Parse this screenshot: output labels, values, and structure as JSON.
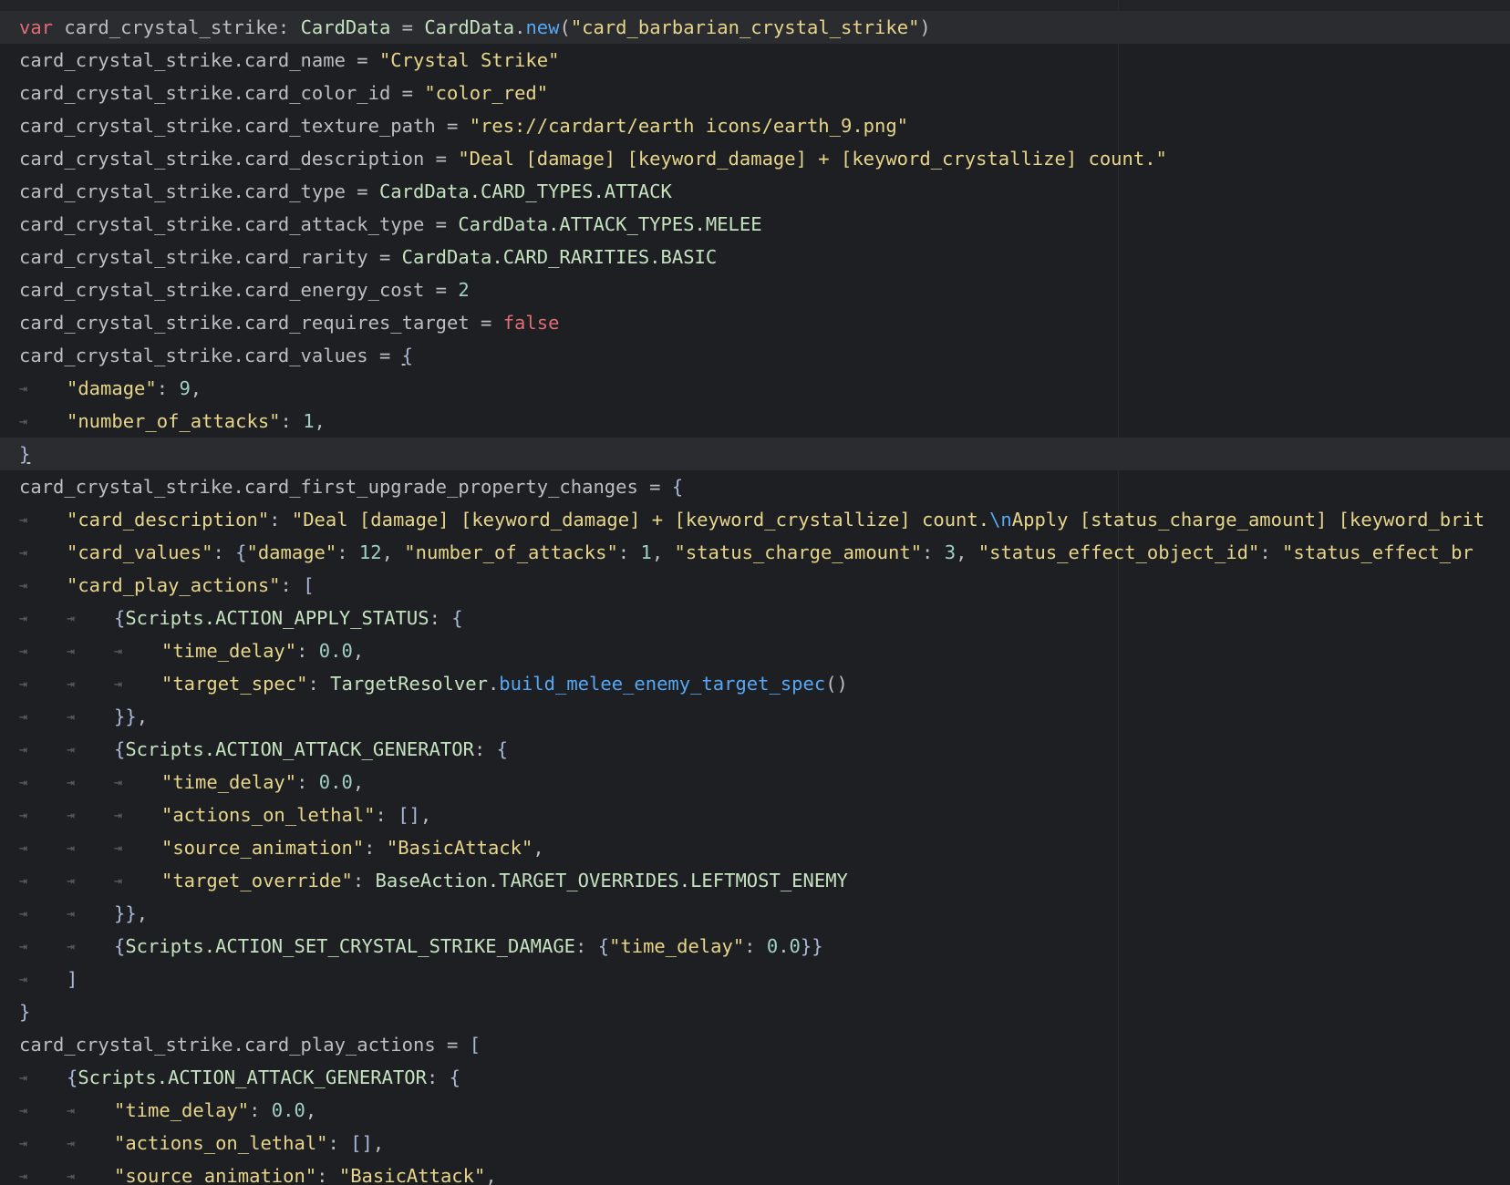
{
  "theme": {
    "background": "#1e1f22",
    "keyword": "#e06c75",
    "string": "#e6d58a",
    "number": "#9fd0c8",
    "function": "#56a8f5",
    "text": "#bcbec4"
  },
  "code": {
    "lines": [
      {
        "indent": 0,
        "highlighted": true,
        "tokens": [
          {
            "t": "var",
            "c": "k"
          },
          {
            "t": " card_crystal_strike: ",
            "c": "p"
          },
          {
            "t": "CardData",
            "c": "t"
          },
          {
            "t": " = ",
            "c": "p"
          },
          {
            "t": "CardData",
            "c": "t"
          },
          {
            "t": ".",
            "c": "p"
          },
          {
            "t": "new",
            "c": "f"
          },
          {
            "t": "(",
            "c": "p"
          },
          {
            "t": "\"card_barbarian_crystal_strike\"",
            "c": "s"
          },
          {
            "t": ")",
            "c": "p"
          }
        ]
      },
      {
        "indent": 0,
        "tokens": [
          {
            "t": "card_crystal_strike.card_name = ",
            "c": "p"
          },
          {
            "t": "\"Crystal Strike\"",
            "c": "s"
          }
        ]
      },
      {
        "indent": 0,
        "tokens": [
          {
            "t": "card_crystal_strike.card_color_id = ",
            "c": "p"
          },
          {
            "t": "\"color_red\"",
            "c": "s"
          }
        ]
      },
      {
        "indent": 0,
        "tokens": [
          {
            "t": "card_crystal_strike.card_texture_path = ",
            "c": "p"
          },
          {
            "t": "\"res://cardart/earth icons/earth_9.png\"",
            "c": "s"
          }
        ]
      },
      {
        "indent": 0,
        "tokens": [
          {
            "t": "card_crystal_strike.card_description = ",
            "c": "p"
          },
          {
            "t": "\"Deal [damage] [keyword_damage] + [keyword_crystallize] count.\"",
            "c": "s"
          }
        ]
      },
      {
        "indent": 0,
        "tokens": [
          {
            "t": "card_crystal_strike.card_type = ",
            "c": "p"
          },
          {
            "t": "CardData.CARD_TYPES.ATTACK",
            "c": "t"
          }
        ]
      },
      {
        "indent": 0,
        "tokens": [
          {
            "t": "card_crystal_strike.card_attack_type = ",
            "c": "p"
          },
          {
            "t": "CardData.ATTACK_TYPES.MELEE",
            "c": "t"
          }
        ]
      },
      {
        "indent": 0,
        "tokens": [
          {
            "t": "card_crystal_strike.card_rarity = ",
            "c": "p"
          },
          {
            "t": "CardData.CARD_RARITIES.BASIC",
            "c": "t"
          }
        ]
      },
      {
        "indent": 0,
        "tokens": [
          {
            "t": "card_crystal_strike.card_energy_cost = ",
            "c": "p"
          },
          {
            "t": "2",
            "c": "n"
          }
        ]
      },
      {
        "indent": 0,
        "tokens": [
          {
            "t": "card_crystal_strike.card_requires_target = ",
            "c": "p"
          },
          {
            "t": "false",
            "c": "k"
          }
        ]
      },
      {
        "indent": 0,
        "tokens": [
          {
            "t": "card_crystal_strike.card_values = ",
            "c": "p"
          },
          {
            "t": "{",
            "c": "br",
            "u": true
          }
        ]
      },
      {
        "indent": 1,
        "tokens": [
          {
            "t": "\"damage\"",
            "c": "s"
          },
          {
            "t": ": ",
            "c": "p"
          },
          {
            "t": "9",
            "c": "n"
          },
          {
            "t": ",",
            "c": "p"
          }
        ]
      },
      {
        "indent": 1,
        "tokens": [
          {
            "t": "\"number_of_attacks\"",
            "c": "s"
          },
          {
            "t": ": ",
            "c": "p"
          },
          {
            "t": "1",
            "c": "n"
          },
          {
            "t": ",",
            "c": "p"
          }
        ]
      },
      {
        "indent": 0,
        "highlighted": true,
        "tokens": [
          {
            "t": "}",
            "c": "br",
            "u": true
          }
        ]
      },
      {
        "indent": 0,
        "tokens": [
          {
            "t": "card_crystal_strike.card_first_upgrade_property_changes = ",
            "c": "p"
          },
          {
            "t": "{",
            "c": "br"
          }
        ]
      },
      {
        "indent": 1,
        "tokens": [
          {
            "t": "\"card_description\"",
            "c": "s"
          },
          {
            "t": ": ",
            "c": "p"
          },
          {
            "t": "\"Deal [damage] [keyword_damage] + [keyword_crystallize] count.",
            "c": "s"
          },
          {
            "t": "\\n",
            "c": "e"
          },
          {
            "t": "Apply [status_charge_amount] [keyword_brit",
            "c": "s"
          }
        ]
      },
      {
        "indent": 1,
        "tokens": [
          {
            "t": "\"card_values\"",
            "c": "s"
          },
          {
            "t": ": ",
            "c": "p"
          },
          {
            "t": "{",
            "c": "br"
          },
          {
            "t": "\"damage\"",
            "c": "s"
          },
          {
            "t": ": ",
            "c": "p"
          },
          {
            "t": "12",
            "c": "n"
          },
          {
            "t": ", ",
            "c": "p"
          },
          {
            "t": "\"number_of_attacks\"",
            "c": "s"
          },
          {
            "t": ": ",
            "c": "p"
          },
          {
            "t": "1",
            "c": "n"
          },
          {
            "t": ", ",
            "c": "p"
          },
          {
            "t": "\"status_charge_amount\"",
            "c": "s"
          },
          {
            "t": ": ",
            "c": "p"
          },
          {
            "t": "3",
            "c": "n"
          },
          {
            "t": ", ",
            "c": "p"
          },
          {
            "t": "\"status_effect_object_id\"",
            "c": "s"
          },
          {
            "t": ": ",
            "c": "p"
          },
          {
            "t": "\"status_effect_br",
            "c": "s"
          }
        ]
      },
      {
        "indent": 1,
        "tokens": [
          {
            "t": "\"card_play_actions\"",
            "c": "s"
          },
          {
            "t": ": ",
            "c": "p"
          },
          {
            "t": "[",
            "c": "br"
          }
        ]
      },
      {
        "indent": 2,
        "tokens": [
          {
            "t": "{",
            "c": "br"
          },
          {
            "t": "Scripts.ACTION_APPLY_STATUS",
            "c": "t"
          },
          {
            "t": ": ",
            "c": "p"
          },
          {
            "t": "{",
            "c": "br"
          }
        ]
      },
      {
        "indent": 3,
        "tokens": [
          {
            "t": "\"time_delay\"",
            "c": "s"
          },
          {
            "t": ": ",
            "c": "p"
          },
          {
            "t": "0.0",
            "c": "n"
          },
          {
            "t": ",",
            "c": "p"
          }
        ]
      },
      {
        "indent": 3,
        "tokens": [
          {
            "t": "\"target_spec\"",
            "c": "s"
          },
          {
            "t": ": ",
            "c": "p"
          },
          {
            "t": "TargetResolver",
            "c": "t"
          },
          {
            "t": ".",
            "c": "p"
          },
          {
            "t": "build_melee_enemy_target_spec",
            "c": "f"
          },
          {
            "t": "()",
            "c": "p"
          }
        ]
      },
      {
        "indent": 2,
        "tokens": [
          {
            "t": "}}",
            "c": "br"
          },
          {
            "t": ",",
            "c": "p"
          }
        ]
      },
      {
        "indent": 2,
        "tokens": [
          {
            "t": "{",
            "c": "br"
          },
          {
            "t": "Scripts.ACTION_ATTACK_GENERATOR",
            "c": "t"
          },
          {
            "t": ": ",
            "c": "p"
          },
          {
            "t": "{",
            "c": "br"
          }
        ]
      },
      {
        "indent": 3,
        "tokens": [
          {
            "t": "\"time_delay\"",
            "c": "s"
          },
          {
            "t": ": ",
            "c": "p"
          },
          {
            "t": "0.0",
            "c": "n"
          },
          {
            "t": ",",
            "c": "p"
          }
        ]
      },
      {
        "indent": 3,
        "tokens": [
          {
            "t": "\"actions_on_lethal\"",
            "c": "s"
          },
          {
            "t": ": ",
            "c": "p"
          },
          {
            "t": "[]",
            "c": "br"
          },
          {
            "t": ",",
            "c": "p"
          }
        ]
      },
      {
        "indent": 3,
        "tokens": [
          {
            "t": "\"source_animation\"",
            "c": "s"
          },
          {
            "t": ": ",
            "c": "p"
          },
          {
            "t": "\"BasicAttack\"",
            "c": "s"
          },
          {
            "t": ",",
            "c": "p"
          }
        ]
      },
      {
        "indent": 3,
        "tokens": [
          {
            "t": "\"target_override\"",
            "c": "s"
          },
          {
            "t": ": ",
            "c": "p"
          },
          {
            "t": "BaseAction.TARGET_OVERRIDES.LEFTMOST_ENEMY",
            "c": "t"
          }
        ]
      },
      {
        "indent": 2,
        "tokens": [
          {
            "t": "}}",
            "c": "br"
          },
          {
            "t": ",",
            "c": "p"
          }
        ]
      },
      {
        "indent": 2,
        "tokens": [
          {
            "t": "{",
            "c": "br"
          },
          {
            "t": "Scripts.ACTION_SET_CRYSTAL_STRIKE_DAMAGE",
            "c": "t"
          },
          {
            "t": ": ",
            "c": "p"
          },
          {
            "t": "{",
            "c": "br"
          },
          {
            "t": "\"time_delay\"",
            "c": "s"
          },
          {
            "t": ": ",
            "c": "p"
          },
          {
            "t": "0.0",
            "c": "n"
          },
          {
            "t": "}}",
            "c": "br"
          }
        ]
      },
      {
        "indent": 1,
        "tokens": [
          {
            "t": "]",
            "c": "br"
          }
        ]
      },
      {
        "indent": 0,
        "tokens": [
          {
            "t": "}",
            "c": "br"
          }
        ]
      },
      {
        "indent": 0,
        "tokens": [
          {
            "t": "card_crystal_strike.card_play_actions = ",
            "c": "p"
          },
          {
            "t": "[",
            "c": "br"
          }
        ]
      },
      {
        "indent": 1,
        "tokens": [
          {
            "t": "{",
            "c": "br"
          },
          {
            "t": "Scripts.ACTION_ATTACK_GENERATOR",
            "c": "t"
          },
          {
            "t": ": ",
            "c": "p"
          },
          {
            "t": "{",
            "c": "br"
          }
        ]
      },
      {
        "indent": 2,
        "tokens": [
          {
            "t": "\"time_delay\"",
            "c": "s"
          },
          {
            "t": ": ",
            "c": "p"
          },
          {
            "t": "0.0",
            "c": "n"
          },
          {
            "t": ",",
            "c": "p"
          }
        ]
      },
      {
        "indent": 2,
        "tokens": [
          {
            "t": "\"actions_on_lethal\"",
            "c": "s"
          },
          {
            "t": ": ",
            "c": "p"
          },
          {
            "t": "[]",
            "c": "br"
          },
          {
            "t": ",",
            "c": "p"
          }
        ]
      },
      {
        "indent": 2,
        "tokens": [
          {
            "t": "\"source_animation\"",
            "c": "s"
          },
          {
            "t": ": ",
            "c": "p"
          },
          {
            "t": "\"BasicAttack\"",
            "c": "s"
          },
          {
            "t": ",",
            "c": "p"
          }
        ]
      }
    ]
  }
}
